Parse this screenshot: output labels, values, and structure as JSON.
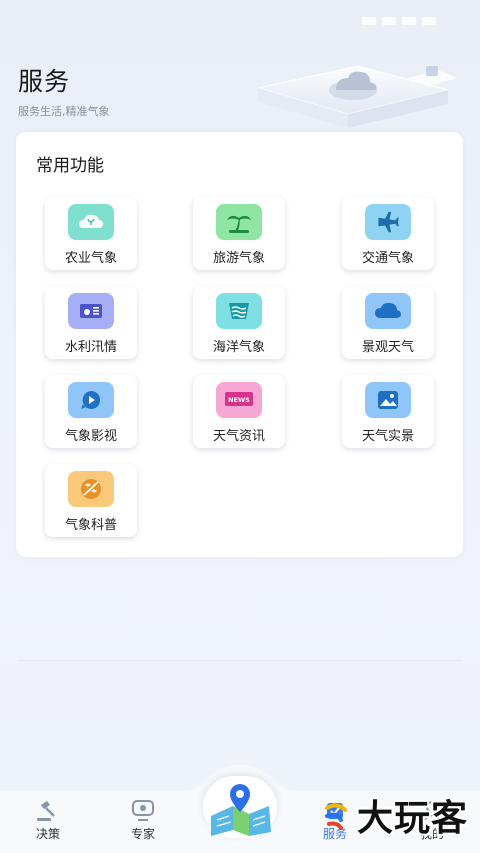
{
  "header": {
    "title": "服务",
    "subtitle": "服务生活,精准气象"
  },
  "card": {
    "title": "常用功能",
    "items": [
      {
        "label": "农业气象",
        "icon": "agriculture-icon",
        "bg": "#7fe0cf"
      },
      {
        "label": "旅游气象",
        "icon": "palm-tree-icon",
        "bg": "#8fe5a3"
      },
      {
        "label": "交通气象",
        "icon": "airplane-icon",
        "bg": "#8ed3f2"
      },
      {
        "label": "水利汛情",
        "icon": "water-gauge-icon",
        "bg": "#a6aef5"
      },
      {
        "label": "海洋气象",
        "icon": "ocean-waves-icon",
        "bg": "#7fe0e3"
      },
      {
        "label": "景观天气",
        "icon": "cloud-icon",
        "bg": "#8fc6f7"
      },
      {
        "label": "气象影视",
        "icon": "video-play-icon",
        "bg": "#8fc6f7"
      },
      {
        "label": "天气资讯",
        "icon": "news-icon",
        "bg": "#f7a7d3"
      },
      {
        "label": "天气实景",
        "icon": "photo-icon",
        "bg": "#8fc6f7"
      },
      {
        "label": "气象科普",
        "icon": "science-icon",
        "bg": "#f9c878"
      }
    ]
  },
  "tabbar": {
    "tabs": [
      {
        "label": "决策",
        "icon": "gavel-icon"
      },
      {
        "label": "专家",
        "icon": "expert-icon"
      },
      {
        "label": "服务",
        "icon": "service-icon"
      },
      {
        "label": "我的",
        "icon": "profile-icon"
      }
    ],
    "center_icon": "map-location-icon",
    "active_color": "#3a7af0"
  },
  "watermark": {
    "text": "大玩客"
  }
}
